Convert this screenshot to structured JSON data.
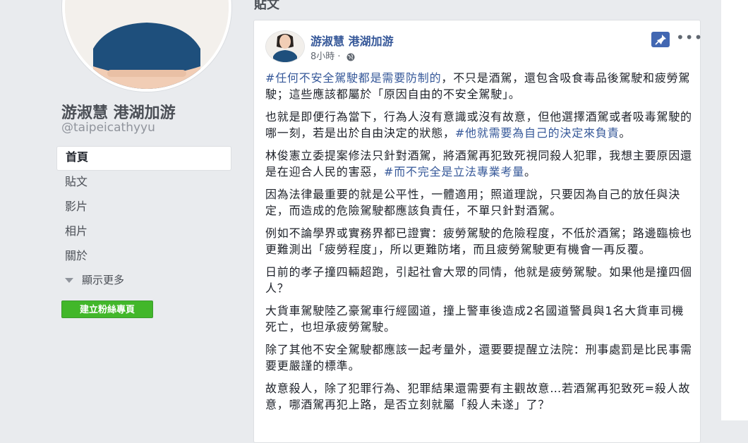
{
  "profile": {
    "name": "游淑慧 港湖加游",
    "handle": "@taipeicathyyu"
  },
  "nav": {
    "items": [
      "首頁",
      "貼文",
      "影片",
      "相片",
      "關於"
    ],
    "show_more": "顯示更多",
    "fan_button": "建立粉絲專頁"
  },
  "feed": {
    "section_title": "貼文"
  },
  "post": {
    "author": "游淑慧 港湖加游",
    "time": "8小時 ·",
    "globe_icon": "globe-icon",
    "pin_icon": "pin-icon",
    "more_icon": "more-options-icon",
    "paragraphs": [
      [
        {
          "t": "#任何不安全駕駛都是需要防制的",
          "tag": true
        },
        {
          "t": "，不只是酒駕，還包含吸食毒品後駕駛和疲勞駕駛；這些應該都屬於「原因自由的不安全駕駛」。",
          "tag": false
        }
      ],
      [
        {
          "t": "也就是即便行為當下，行為人沒有意識或沒有故意，但他選擇酒駕或者吸毒駕駛的哪一刻，若是出於自由決定的狀態，",
          "tag": false
        },
        {
          "t": "#他就需要為自己的決定來負責",
          "tag": true
        },
        {
          "t": "。",
          "tag": false
        }
      ],
      [
        {
          "t": "林俊憲立委提案修法只針對酒駕，將酒駕再犯致死視同殺人犯罪，我想主要原因還是在迎合人民的害惡，",
          "tag": false
        },
        {
          "t": "#而不完全是立法專業考量",
          "tag": true
        },
        {
          "t": "。",
          "tag": false
        }
      ],
      [
        {
          "t": "因為法律最重要的就是公平性，一體適用；照道理說，只要因為自己的放任與決定，而造成的危險駕駛都應該負責任，不單只針對酒駕。",
          "tag": false
        }
      ],
      [
        {
          "t": "例如不論學界或實務界都已證實：疲勞駕駛的危險程度，不低於酒駕；路邊臨檢也更難測出「疲勞程度」，所以更難防堵，而且疲勞駕駛更有機會一再反覆。",
          "tag": false
        }
      ],
      [
        {
          "t": "日前的孝子撞四輛超跑，引起社會大眾的同情，他就是疲勞駕駛。如果他是撞四個人？",
          "tag": false
        }
      ],
      [
        {
          "t": "大貨車駕駛陸乙豪駕車行經國道，撞上警車後造成2名國道警員與1名大貨車司機死亡，也坦承疲勞駕駛。",
          "tag": false
        }
      ],
      [
        {
          "t": "除了其他不安全駕駛都應該一起考量外，還要要提醒立法院：刑事處罰是比民事需要更嚴謹的標準。",
          "tag": false
        }
      ],
      [
        {
          "t": "故意殺人，除了犯罪行為、犯罪結果還需要有主觀故意…若酒駕再犯致死=殺人故意，哪酒駕再犯上路，是否立刻就屬「殺人未遂」了？",
          "tag": false
        }
      ]
    ]
  },
  "colors": {
    "link": "#365899",
    "button_green": "#42b72a",
    "pin_blue": "#4267b2",
    "background": "#e9ebee"
  }
}
